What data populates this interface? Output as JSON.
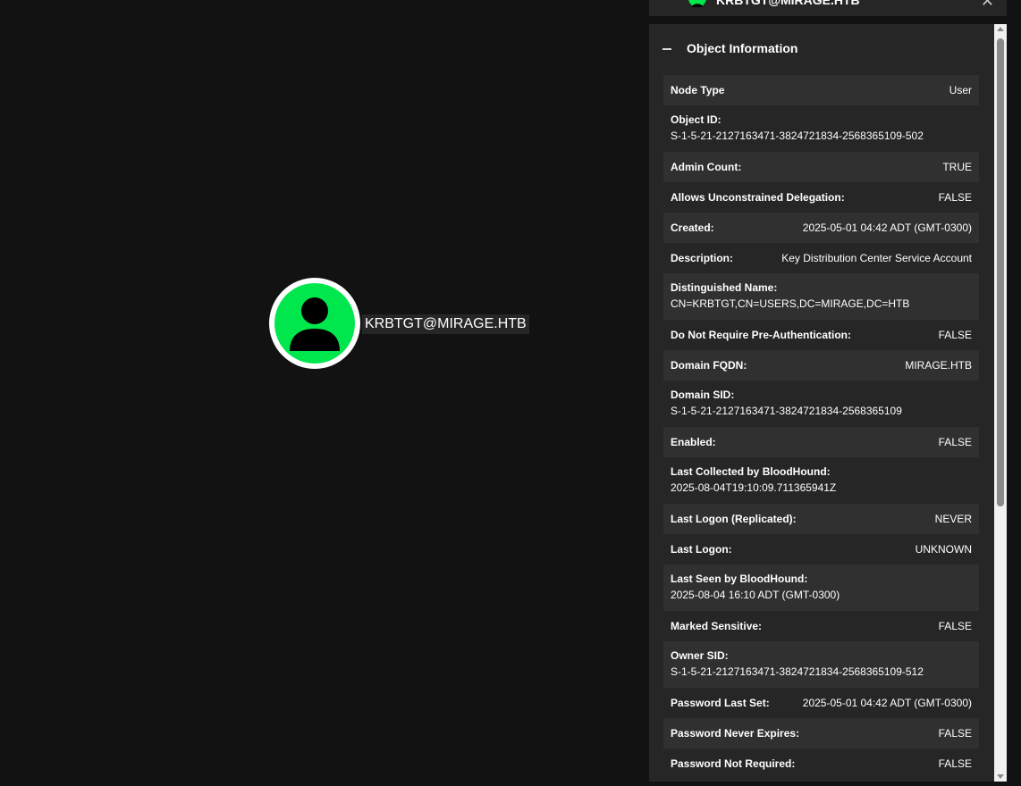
{
  "graph": {
    "node_label": "KRBTGT@MIRAGE.HTB",
    "node_color": "#00e74d",
    "node_icon": "user-icon"
  },
  "header": {
    "title": "KRBTGT@MIRAGE.HTB",
    "icon": "user-icon",
    "close_label": "✕"
  },
  "panel": {
    "title": "Object Information",
    "properties": [
      {
        "key": "Node Type",
        "value": "User",
        "layout": "single"
      },
      {
        "key": "Object ID:",
        "value": "S-1-5-21-2127163471-3824721834-2568365109-502",
        "layout": "double"
      },
      {
        "key": "Admin Count:",
        "value": "TRUE",
        "layout": "single"
      },
      {
        "key": "Allows Unconstrained Delegation:",
        "value": "FALSE",
        "layout": "single"
      },
      {
        "key": "Created:",
        "value": "2025-05-01 04:42 ADT (GMT-0300)",
        "layout": "single"
      },
      {
        "key": "Description:",
        "value": "Key Distribution Center Service Account",
        "layout": "single"
      },
      {
        "key": "Distinguished Name:",
        "value": "CN=KRBTGT,CN=USERS,DC=MIRAGE,DC=HTB",
        "layout": "double"
      },
      {
        "key": "Do Not Require Pre-Authentication:",
        "value": "FALSE",
        "layout": "single"
      },
      {
        "key": "Domain FQDN:",
        "value": "MIRAGE.HTB",
        "layout": "single"
      },
      {
        "key": "Domain SID:",
        "value": "S-1-5-21-2127163471-3824721834-2568365109",
        "layout": "double"
      },
      {
        "key": "Enabled:",
        "value": "FALSE",
        "layout": "single"
      },
      {
        "key": "Last Collected by BloodHound:",
        "value": "2025-08-04T19:10:09.711365941Z",
        "layout": "double"
      },
      {
        "key": "Last Logon (Replicated):",
        "value": "NEVER",
        "layout": "single"
      },
      {
        "key": "Last Logon:",
        "value": "UNKNOWN",
        "layout": "single"
      },
      {
        "key": "Last Seen by BloodHound:",
        "value": "2025-08-04 16:10 ADT (GMT-0300)",
        "layout": "double"
      },
      {
        "key": "Marked Sensitive:",
        "value": "FALSE",
        "layout": "single"
      },
      {
        "key": "Owner SID:",
        "value": "S-1-5-21-2127163471-3824721834-2568365109-512",
        "layout": "double"
      },
      {
        "key": "Password Last Set:",
        "value": "2025-05-01 04:42 ADT (GMT-0300)",
        "layout": "single"
      },
      {
        "key": "Password Never Expires:",
        "value": "FALSE",
        "layout": "single"
      },
      {
        "key": "Password Not Required:",
        "value": "FALSE",
        "layout": "single"
      }
    ]
  },
  "colors": {
    "background": "#121212",
    "panel": "#262626",
    "row_alt": "#303030",
    "accent": "#00e74d"
  }
}
